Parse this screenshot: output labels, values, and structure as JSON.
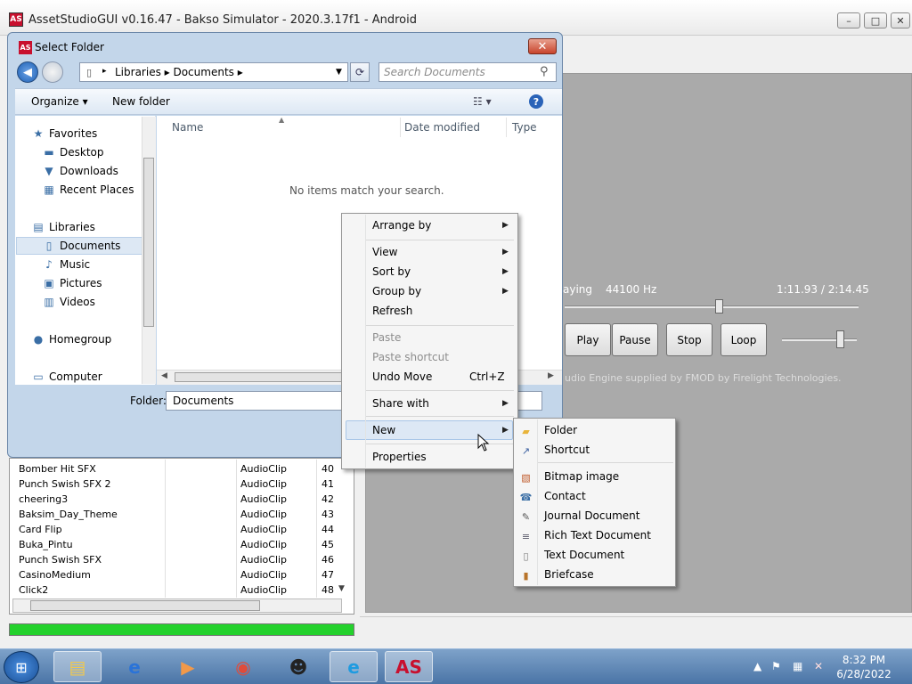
{
  "app": {
    "title": "AssetStudioGUI v0.16.47 - Bakso Simulator - 2020.3.17f1 - Android",
    "logo": "AS",
    "minimize": "–",
    "maximize": "□",
    "close": "✕"
  },
  "player": {
    "status": "aying",
    "rate": "44100 Hz",
    "time": "1:11.93 / 2:14.45",
    "buttons": [
      "Play",
      "Pause",
      "Stop",
      "Loop"
    ],
    "credit": "udio Engine supplied by FMOD by Firelight Technologies."
  },
  "asset_list": {
    "rows": [
      {
        "name": "Bomber Hit SFX",
        "type": "AudioClip",
        "id": "40"
      },
      {
        "name": "Punch Swish SFX 2",
        "type": "AudioClip",
        "id": "41"
      },
      {
        "name": "cheering3",
        "type": "AudioClip",
        "id": "42"
      },
      {
        "name": "Baksim_Day_Theme",
        "type": "AudioClip",
        "id": "43"
      },
      {
        "name": "Card Flip",
        "type": "AudioClip",
        "id": "44"
      },
      {
        "name": "Buka_Pintu",
        "type": "AudioClip",
        "id": "45"
      },
      {
        "name": "Punch Swish SFX",
        "type": "AudioClip",
        "id": "46"
      },
      {
        "name": "CasinoMedium",
        "type": "AudioClip",
        "id": "47"
      },
      {
        "name": "Click2",
        "type": "AudioClip",
        "id": "48"
      }
    ]
  },
  "dialog": {
    "title": "Select Folder",
    "logo": "AS",
    "close": "✕",
    "address": "Libraries  ▸  Documents  ▸",
    "search_placeholder": "Search Documents",
    "organize": "Organize ▾",
    "new_folder": "New folder",
    "help": "?",
    "columns": [
      "Name",
      "Date modified",
      "Type"
    ],
    "empty_message": "No items match your search.",
    "folder_label": "Folder:",
    "folder_value": "Documents",
    "nav": [
      {
        "label": "Favorites",
        "icon": "★",
        "icon_name": "favorites-star-icon"
      },
      {
        "label": "Desktop",
        "icon": "▬",
        "icon_name": "desktop-icon"
      },
      {
        "label": "Downloads",
        "icon": "▼",
        "icon_name": "downloads-icon"
      },
      {
        "label": "Recent Places",
        "icon": "▦",
        "icon_name": "recent-places-icon"
      },
      {
        "label": "Libraries",
        "icon": "▤",
        "icon_name": "libraries-icon"
      },
      {
        "label": "Documents",
        "icon": "▯",
        "icon_name": "documents-icon"
      },
      {
        "label": "Music",
        "icon": "♪",
        "icon_name": "music-icon"
      },
      {
        "label": "Pictures",
        "icon": "▣",
        "icon_name": "pictures-icon"
      },
      {
        "label": "Videos",
        "icon": "▥",
        "icon_name": "videos-icon"
      },
      {
        "label": "Homegroup",
        "icon": "●",
        "icon_name": "homegroup-icon"
      },
      {
        "label": "Computer",
        "icon": "▭",
        "icon_name": "computer-icon"
      }
    ]
  },
  "context_menu": {
    "items": [
      {
        "label": "Arrange by",
        "submenu": true
      },
      {
        "label": "View",
        "submenu": true
      },
      {
        "label": "Sort by",
        "submenu": true
      },
      {
        "label": "Group by",
        "submenu": true
      },
      {
        "label": "Refresh"
      },
      {
        "label": "Paste",
        "disabled": true
      },
      {
        "label": "Paste shortcut",
        "disabled": true
      },
      {
        "label": "Undo Move",
        "shortcut": "Ctrl+Z"
      },
      {
        "label": "Share with",
        "submenu": true
      },
      {
        "label": "New",
        "submenu": true,
        "highlighted": true
      },
      {
        "label": "Properties"
      }
    ]
  },
  "new_menu": {
    "items": [
      {
        "label": "Folder",
        "icon_name": "folder-icon"
      },
      {
        "label": "Shortcut",
        "icon_name": "shortcut-icon"
      },
      {
        "label": "Bitmap image",
        "icon_name": "bitmap-icon"
      },
      {
        "label": "Contact",
        "icon_name": "contact-icon"
      },
      {
        "label": "Journal Document",
        "icon_name": "journal-icon"
      },
      {
        "label": "Rich Text Document",
        "icon_name": "rich-text-icon"
      },
      {
        "label": "Text Document",
        "icon_name": "text-document-icon"
      },
      {
        "label": "Briefcase",
        "icon_name": "briefcase-icon"
      }
    ]
  },
  "taskbar": {
    "time": "8:32 PM",
    "date": "6/28/2022",
    "apps": [
      "file-explorer-icon",
      "internet-explorer-icon",
      "media-player-icon",
      "chrome-icon",
      "raccoon-app-icon",
      "edge-icon",
      "assetstudio-icon"
    ]
  }
}
